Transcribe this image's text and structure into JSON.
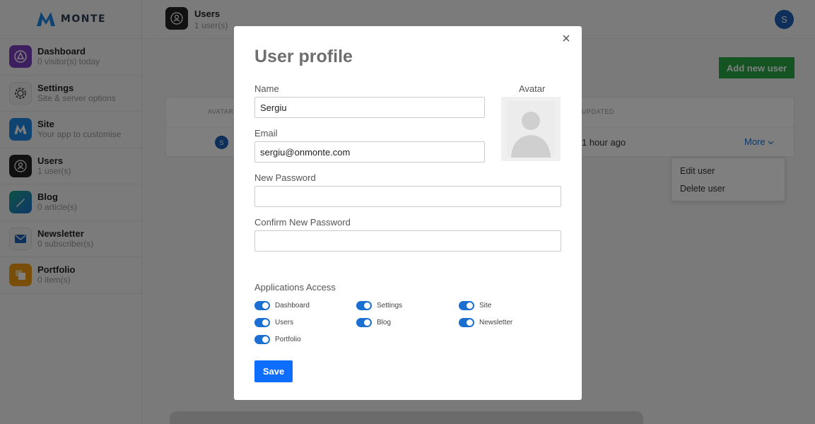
{
  "app": {
    "name": "MONTE"
  },
  "sidebar": {
    "items": [
      {
        "title": "Dashboard",
        "sub": "0 visitor(s) today",
        "icon": "dashboard-icon",
        "color": "#7b3fbf"
      },
      {
        "title": "Settings",
        "sub": "Site & server options",
        "icon": "gear-icon",
        "color": "#eeeeee"
      },
      {
        "title": "Site",
        "sub": "Your app to customise",
        "icon": "site-icon",
        "color": "#1e88e5"
      },
      {
        "title": "Users",
        "sub": "1 user(s)",
        "icon": "user-icon",
        "color": "#222222"
      },
      {
        "title": "Blog",
        "sub": "0 article(s)",
        "icon": "blog-icon",
        "color": "#1aa38a"
      },
      {
        "title": "Newsletter",
        "sub": "0 subscriber(s)",
        "icon": "envelope-icon",
        "color": "#f0f0f0"
      },
      {
        "title": "Portfolio",
        "sub": "0 item(s)",
        "icon": "portfolio-icon",
        "color": "#f39c12"
      }
    ]
  },
  "header": {
    "title": "Users",
    "sub": "1 user(s)",
    "user_initial": "S"
  },
  "main": {
    "add_button": "Add new user",
    "columns": {
      "avatar": "AVATAR",
      "updated": "UPDATED"
    },
    "rows": [
      {
        "avatar_initial": "S",
        "updated": "1 hour ago",
        "more": "More"
      }
    ],
    "dropdown": [
      "Edit user",
      "Delete user"
    ]
  },
  "modal": {
    "title": "User profile",
    "name_label": "Name",
    "name_value": "Sergiu",
    "email_label": "Email",
    "email_value": "sergiu@onmonte.com",
    "new_password_label": "New Password",
    "confirm_password_label": "Confirm New Password",
    "avatar_label": "Avatar",
    "access_label": "Applications Access",
    "apps": [
      "Dashboard",
      "Settings",
      "Site",
      "Users",
      "Blog",
      "Newsletter",
      "Portfolio"
    ],
    "save_label": "Save",
    "close_label": "×"
  },
  "colors": {
    "accent": "#0d6efd",
    "success": "#28a745",
    "link": "#1a6fd0"
  }
}
